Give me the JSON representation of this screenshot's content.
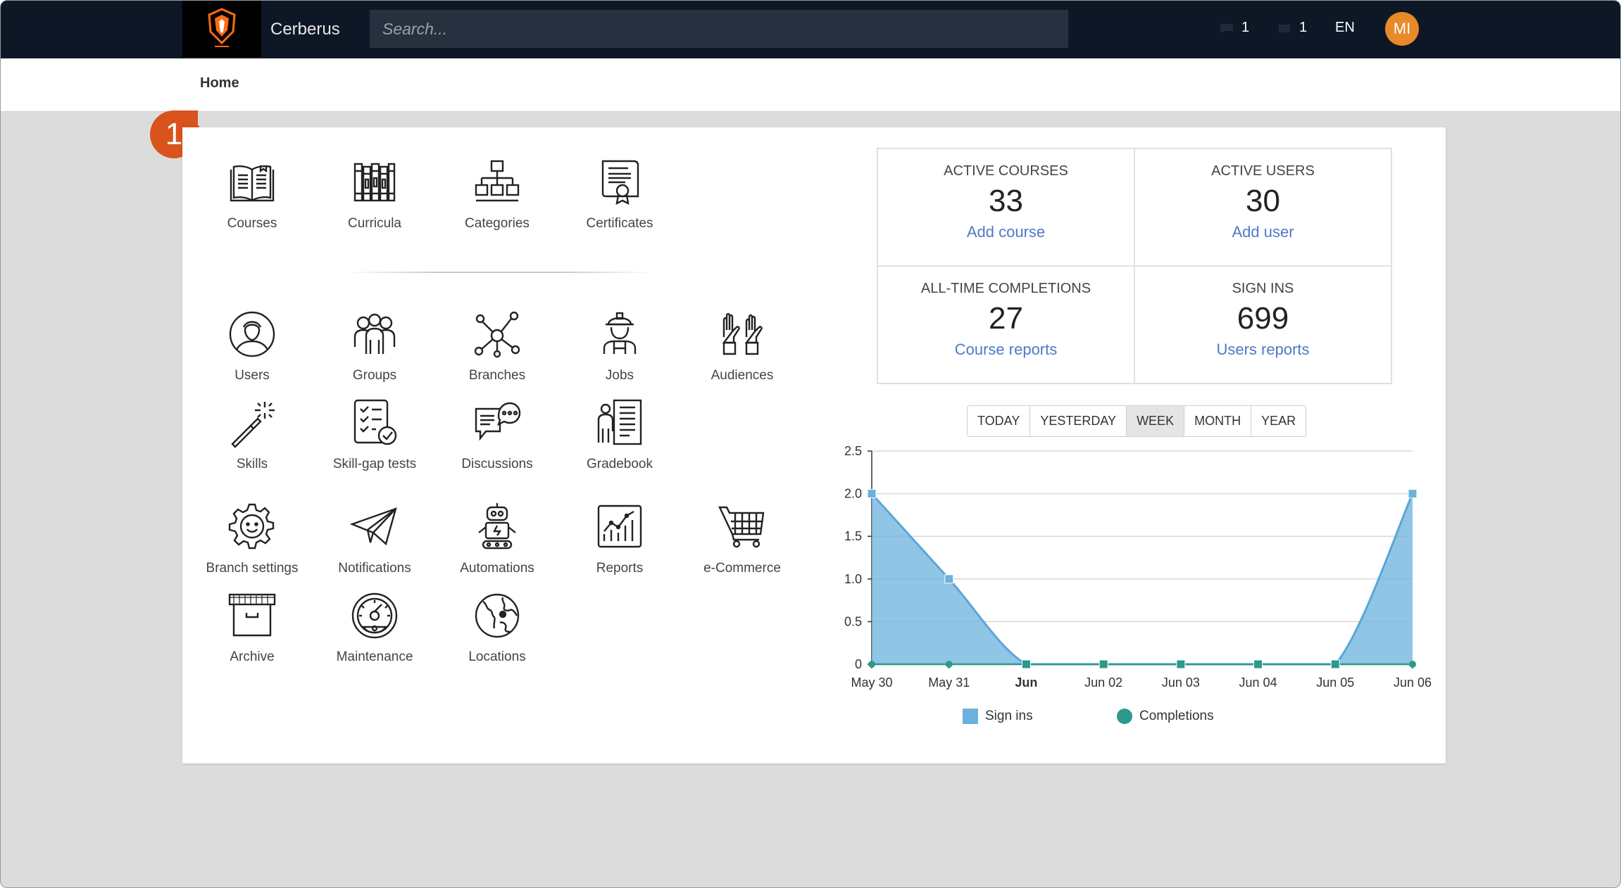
{
  "app": {
    "name": "Cerberus",
    "logo_icon": "cerberus-shield-icon"
  },
  "search": {
    "placeholder": "Search..."
  },
  "topbar": {
    "counter_1": {
      "icon": "messages-icon",
      "value": "1"
    },
    "counter_2": {
      "icon": "notifications-icon",
      "value": "1"
    },
    "language": "EN",
    "avatar_initials": "MI",
    "avatar_color": "#e8892a"
  },
  "breadcrumb": "Home",
  "callout": {
    "number": "1",
    "color": "#d9541c"
  },
  "menu": {
    "row1": [
      {
        "label": "Courses",
        "icon": "book-icon"
      },
      {
        "label": "Curricula",
        "icon": "bookshelf-icon"
      },
      {
        "label": "Categories",
        "icon": "hierarchy-icon"
      },
      {
        "label": "Certificates",
        "icon": "certificate-icon"
      }
    ],
    "row2": [
      {
        "label": "Users",
        "icon": "user-icon"
      },
      {
        "label": "Groups",
        "icon": "group-icon"
      },
      {
        "label": "Branches",
        "icon": "network-icon"
      },
      {
        "label": "Jobs",
        "icon": "worker-icon"
      },
      {
        "label": "Audiences",
        "icon": "raised-hands-icon"
      }
    ],
    "row3": [
      {
        "label": "Skills",
        "icon": "magic-wand-icon"
      },
      {
        "label": "Skill-gap tests",
        "icon": "checklist-icon"
      },
      {
        "label": "Discussions",
        "icon": "chat-bubbles-icon"
      },
      {
        "label": "Gradebook",
        "icon": "gradebook-icon"
      }
    ],
    "row4": [
      {
        "label": "Branch settings",
        "icon": "gear-icon"
      },
      {
        "label": "Notifications",
        "icon": "paper-plane-icon"
      },
      {
        "label": "Automations",
        "icon": "robot-icon"
      },
      {
        "label": "Reports",
        "icon": "chart-icon"
      },
      {
        "label": "e-Commerce",
        "icon": "cart-icon"
      }
    ],
    "row5": [
      {
        "label": "Archive",
        "icon": "archive-box-icon"
      },
      {
        "label": "Maintenance",
        "icon": "dashboard-gauge-icon"
      },
      {
        "label": "Locations",
        "icon": "globe-icon"
      }
    ]
  },
  "stats": {
    "active_courses": {
      "title": "ACTIVE COURSES",
      "value": "33",
      "action": "Add course"
    },
    "active_users": {
      "title": "ACTIVE USERS",
      "value": "30",
      "action": "Add user"
    },
    "completions": {
      "title": "ALL-TIME COMPLETIONS",
      "value": "27",
      "action": "Course reports"
    },
    "sign_ins": {
      "title": "SIGN INS",
      "value": "699",
      "action": "Users reports"
    },
    "link_color": "#4f79c6"
  },
  "range_tabs": [
    "TODAY",
    "YESTERDAY",
    "WEEK",
    "MONTH",
    "YEAR"
  ],
  "range_selected": "WEEK",
  "chart_data": {
    "type": "area",
    "categories": [
      "May 30",
      "May 31",
      "Jun",
      "Jun 02",
      "Jun 03",
      "Jun 04",
      "Jun 05",
      "Jun 06"
    ],
    "bold_tick": "Jun",
    "series": [
      {
        "name": "Sign ins",
        "values": [
          2,
          1,
          0,
          0,
          0,
          0,
          0,
          2
        ],
        "color": "#6cb1dd",
        "marker": "square"
      },
      {
        "name": "Completions",
        "values": [
          0,
          0,
          0,
          0,
          0,
          0,
          0,
          0
        ],
        "color": "#2b9a8a",
        "marker": "circle"
      }
    ],
    "ylim": [
      0,
      2.5
    ],
    "yticks": [
      "0",
      "0.5",
      "1.0",
      "1.5",
      "2.0",
      "2.5"
    ],
    "grid": true,
    "legend": "bottom"
  }
}
